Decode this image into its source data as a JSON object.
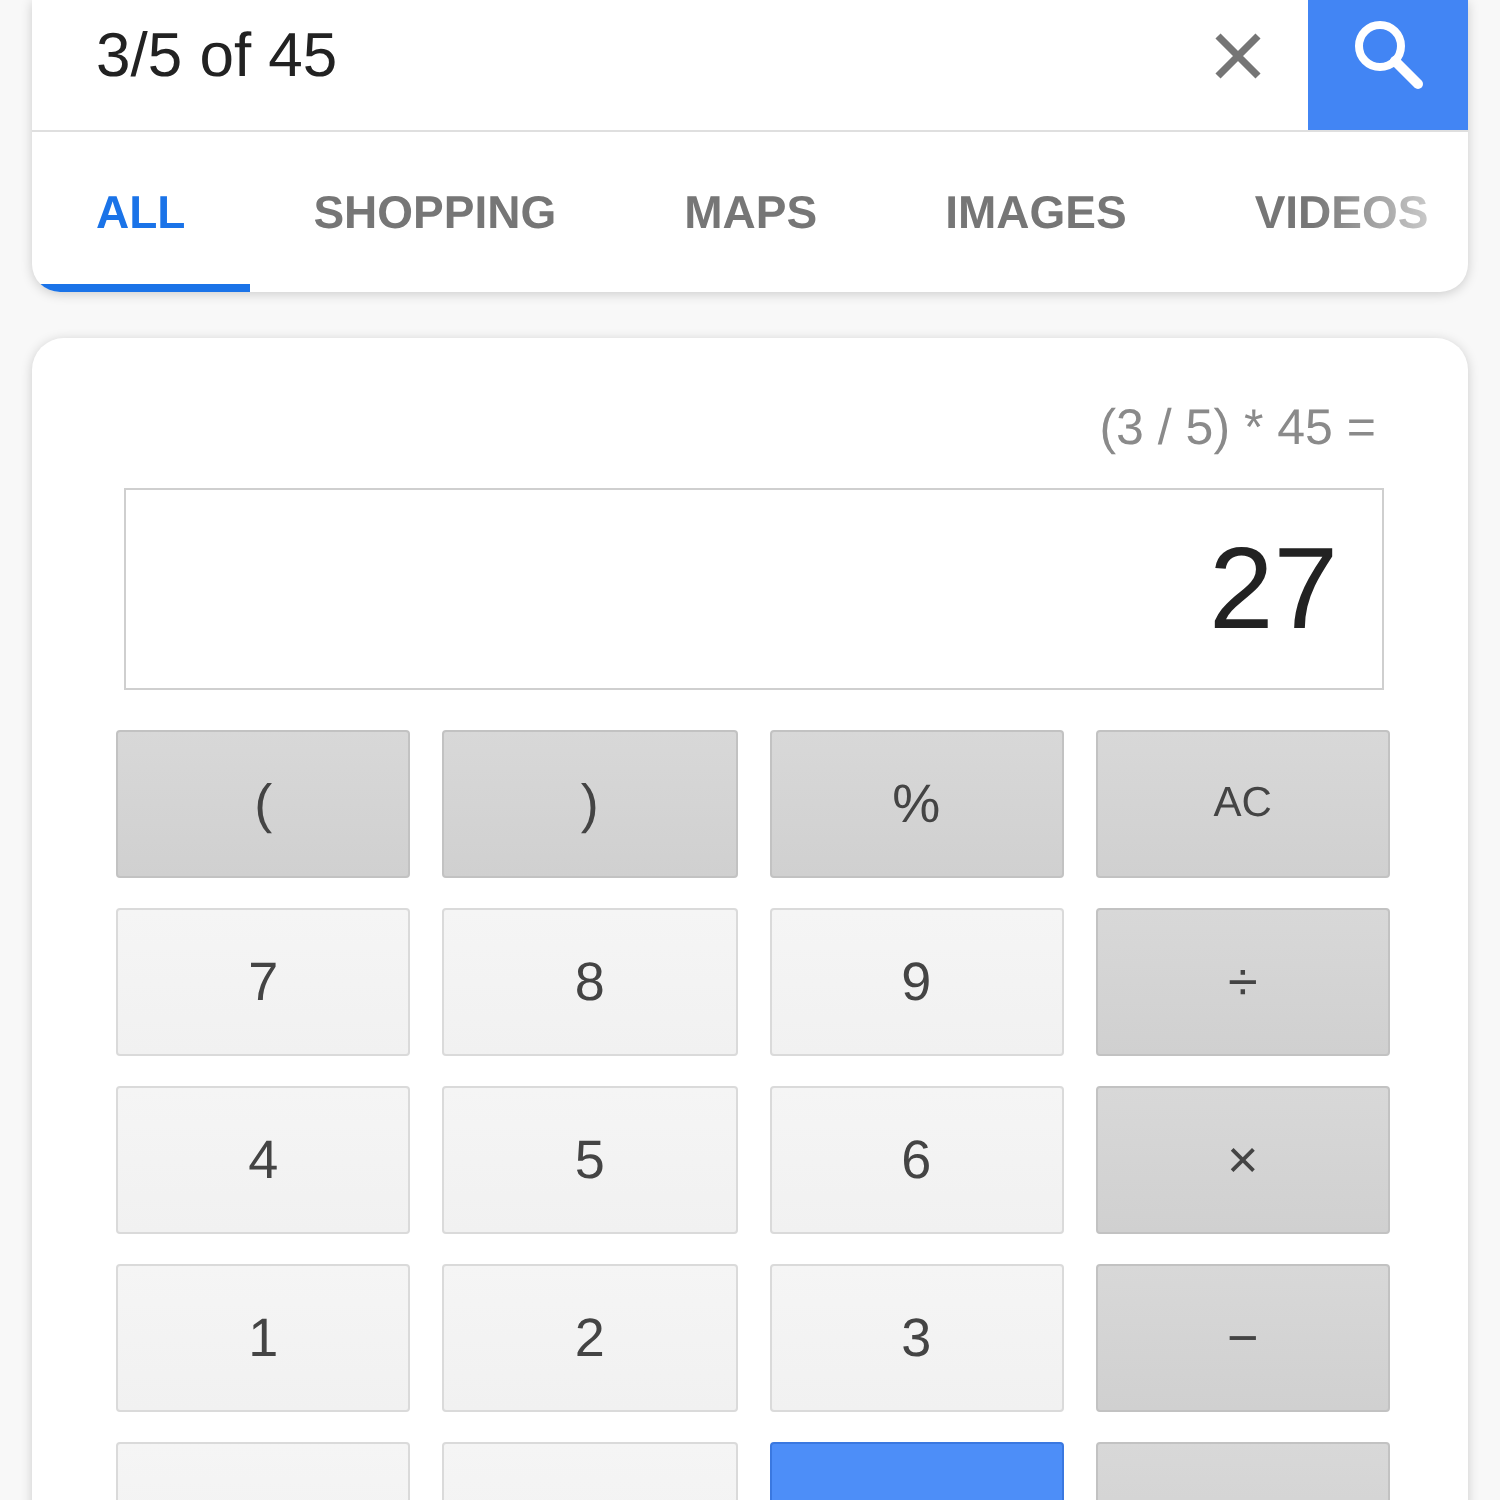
{
  "search": {
    "query": "3/5 of 45"
  },
  "tabs": [
    {
      "label": "ALL",
      "selected": true
    },
    {
      "label": "SHOPPING",
      "selected": false
    },
    {
      "label": "MAPS",
      "selected": false
    },
    {
      "label": "IMAGES",
      "selected": false
    },
    {
      "label": "VIDEOS",
      "selected": false
    }
  ],
  "calculator": {
    "expression": "(3 / 5) * 45 =",
    "result": "27",
    "keys": [
      [
        {
          "label": "(",
          "kind": "function"
        },
        {
          "label": ")",
          "kind": "function"
        },
        {
          "label": "%",
          "kind": "function"
        },
        {
          "label": "AC",
          "kind": "clear"
        }
      ],
      [
        {
          "label": "7",
          "kind": "digit"
        },
        {
          "label": "8",
          "kind": "digit"
        },
        {
          "label": "9",
          "kind": "digit"
        },
        {
          "label": "÷",
          "kind": "operator"
        }
      ],
      [
        {
          "label": "4",
          "kind": "digit"
        },
        {
          "label": "5",
          "kind": "digit"
        },
        {
          "label": "6",
          "kind": "digit"
        },
        {
          "label": "×",
          "kind": "operator"
        }
      ],
      [
        {
          "label": "1",
          "kind": "digit"
        },
        {
          "label": "2",
          "kind": "digit"
        },
        {
          "label": "3",
          "kind": "digit"
        },
        {
          "label": "−",
          "kind": "operator"
        }
      ],
      [
        {
          "kind": "digit"
        },
        {
          "kind": "digit"
        },
        {
          "kind": "equals"
        },
        {
          "kind": "operator"
        }
      ]
    ]
  }
}
